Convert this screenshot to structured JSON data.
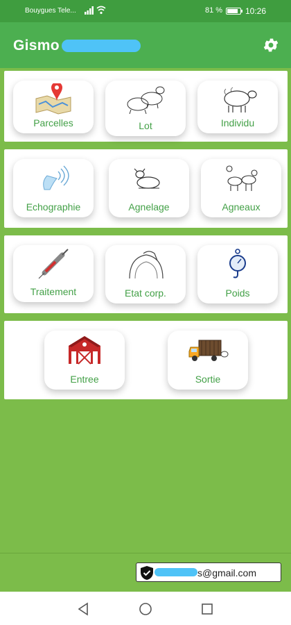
{
  "status": {
    "carrier": "Bouygues Tele...",
    "battery_pct": "81 %",
    "battery_level": 0.81,
    "time": "10:26"
  },
  "app": {
    "title": "Gismo",
    "settings_icon": "gear-icon"
  },
  "menu": {
    "row1": [
      {
        "label": "Parcelles",
        "icon": "map-pin-icon"
      },
      {
        "label": "Lot",
        "icon": "sheep-group-icon"
      },
      {
        "label": "Individu",
        "icon": "sheep-icon"
      }
    ],
    "row2": [
      {
        "label": "Echographie",
        "icon": "ultrasound-probe-icon"
      },
      {
        "label": "Agnelage",
        "icon": "lambing-icon"
      },
      {
        "label": "Agneaux",
        "icon": "lambs-icon"
      }
    ],
    "row3": [
      {
        "label": "Traitement",
        "icon": "syringe-icon"
      },
      {
        "label": "Etat corp.",
        "icon": "body-condition-icon"
      },
      {
        "label": "Poids",
        "icon": "scale-icon"
      }
    ],
    "row4": [
      {
        "label": "Entree",
        "icon": "barn-icon"
      },
      {
        "label": "Sortie",
        "icon": "truck-icon"
      }
    ]
  },
  "footer": {
    "email": "s@gmail.com",
    "account_icon": "shield-check-icon"
  },
  "colors": {
    "status_bar": "#3f9d3f",
    "app_bar": "#4caf50",
    "background": "#7cbc4a",
    "label_green": "#43a047"
  }
}
